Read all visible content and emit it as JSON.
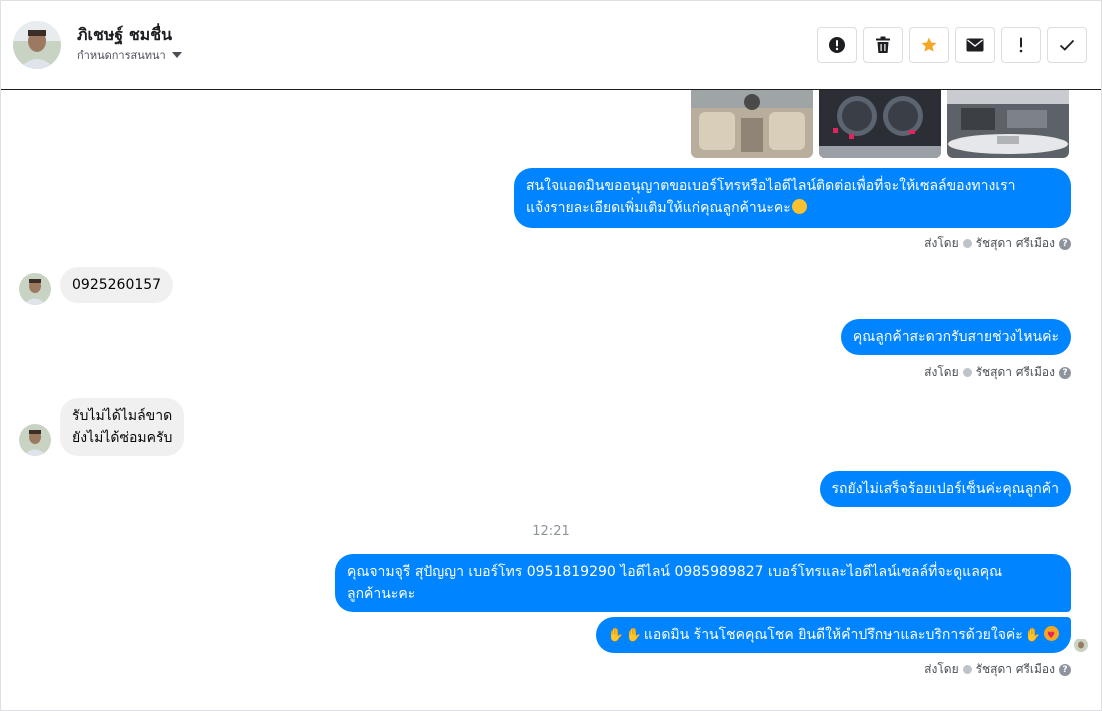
{
  "contact": {
    "name": "ภิเชษฐ์ ชมชื่น",
    "subtitle": "กำหนดการสนทนา"
  },
  "toolbar": [
    {
      "name": "spam-button",
      "icon": "alert-circle-icon",
      "color": "#1c1e21"
    },
    {
      "name": "delete-button",
      "icon": "trash-icon",
      "color": "#1c1e21"
    },
    {
      "name": "star-button",
      "icon": "star-icon",
      "color": "#f5a623"
    },
    {
      "name": "mark-unread-button",
      "icon": "envelope-icon",
      "color": "#1c1e21"
    },
    {
      "name": "follow-up-button",
      "icon": "exclamation-icon",
      "color": "#1c1e21"
    },
    {
      "name": "done-button",
      "icon": "check-icon",
      "color": "#1c1e21"
    }
  ],
  "messages": {
    "m1": "สนใจแอดมินขออนุญาตขอเบอร์โทรหรือไอดีไลน์ติดต่อเพื่อที่จะให้เซลล์ของทางเรา",
    "m1b": "แจ้งรายละเอียดเพิ่มเติมให้แก่คุณลูกค้านะคะ",
    "m2": "0925260157",
    "m3": "คุณลูกค้าสะดวกรับสายช่วงไหนค่ะ",
    "m4a": "รับไม่ได้ไมล์ขาด",
    "m4b": "ยังไม่ได้ซ่อมครับ",
    "m5": "รถยังไม่เสร็จร้อยเปอร์เซ็นค่ะคุณลูกค้า",
    "m6a": "คุณจามจุรี สุปัญญา เบอร์โทร 0951819290  ไอดีไลน์ 0985989827   เบอร์โทรและไอดีไลน์เซลล์ที่จะดูแลคุณ",
    "m6b": "ลูกค้านะคะ",
    "m7": "แอดมิน ร้านโชคคุณโชค ยินดีให้คำปรึกษาและบริการด้วยใจค่ะ"
  },
  "sent_by": {
    "label": "ส่งโดย",
    "agent": "รัชสุดา ศรีเมือง"
  },
  "timestamp": "12:21",
  "colors": {
    "outgoing_bubble": "#0084ff",
    "incoming_bubble": "#f0f0f0",
    "star": "#f5a623"
  }
}
